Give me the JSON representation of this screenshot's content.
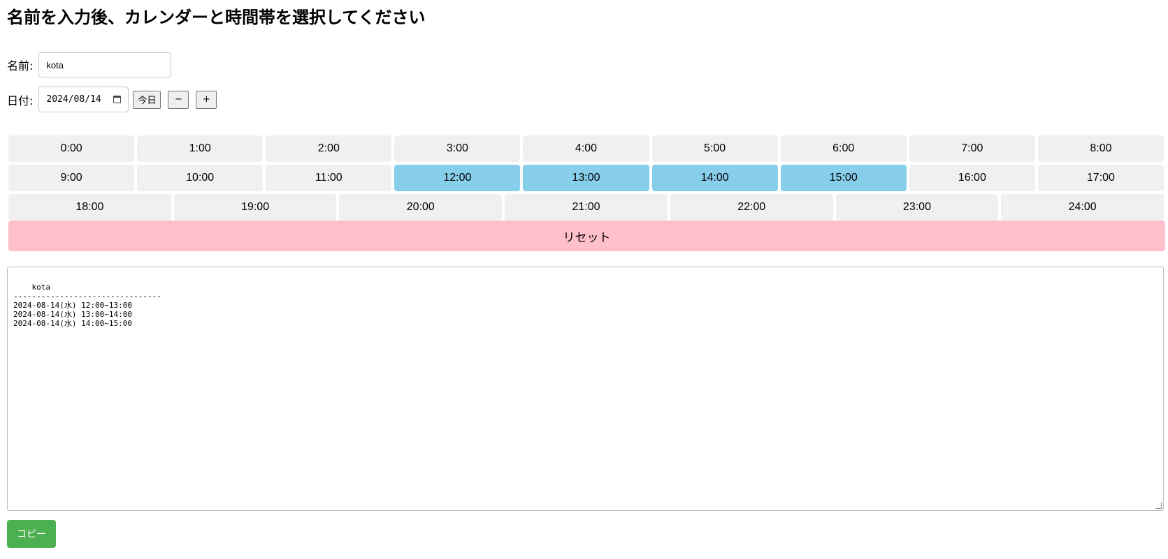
{
  "title": "名前を入力後、カレンダーと時間帯を選択してください",
  "name_label": "名前:",
  "name_value": "kota",
  "date_label": "日付:",
  "date_value": "2024/08/14",
  "buttons": {
    "today": "今日",
    "minus": "−",
    "plus": "+",
    "reset": "リセット",
    "copy": "コピー"
  },
  "time_rows": [
    [
      "0:00",
      "1:00",
      "2:00",
      "3:00",
      "4:00",
      "5:00",
      "6:00",
      "7:00",
      "8:00"
    ],
    [
      "9:00",
      "10:00",
      "11:00",
      "12:00",
      "13:00",
      "14:00",
      "15:00",
      "16:00",
      "17:00"
    ],
    [
      "18:00",
      "19:00",
      "20:00",
      "21:00",
      "22:00",
      "23:00",
      "24:00"
    ]
  ],
  "selected_times": [
    "12:00",
    "13:00",
    "14:00",
    "15:00"
  ],
  "colors": {
    "slot_default": "#f0f0f0",
    "slot_selected": "#87ceeb",
    "reset_bg": "#ffc0cb",
    "copy_bg": "#4caf50"
  },
  "output_text": "kota\n--------------------------------\n2024-08-14(水) 12:00~13:00\n2024-08-14(水) 13:00~14:00\n2024-08-14(水) 14:00~15:00"
}
